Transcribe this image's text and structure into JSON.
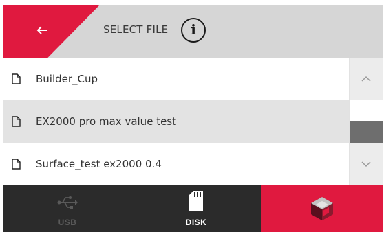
{
  "header": {
    "title": "SELECT FILE",
    "back_icon": "arrow-left-icon",
    "info_icon": "info-icon",
    "info_glyph": "i"
  },
  "files": [
    {
      "name": "Builder_Cup",
      "icon": "file-icon"
    },
    {
      "name": "EX2000 pro max value test",
      "icon": "file-icon"
    },
    {
      "name": "Surface_test ex2000 0.4",
      "icon": "file-icon"
    }
  ],
  "scrollbar": {
    "up_icon": "chevron-up-icon",
    "down_icon": "chevron-down-icon"
  },
  "tabs": [
    {
      "label": "USB",
      "icon": "usb-icon",
      "active": false
    },
    {
      "label": "DISK",
      "icon": "sd-card-icon",
      "active": true
    },
    {
      "label": "",
      "icon": "brand-cube-icon",
      "active": false
    }
  ],
  "colors": {
    "accent": "#e0193f",
    "header_bg": "#d6d6d6",
    "bottom_bar": "#2b2b2b",
    "row_alt": "#e3e3e3"
  }
}
